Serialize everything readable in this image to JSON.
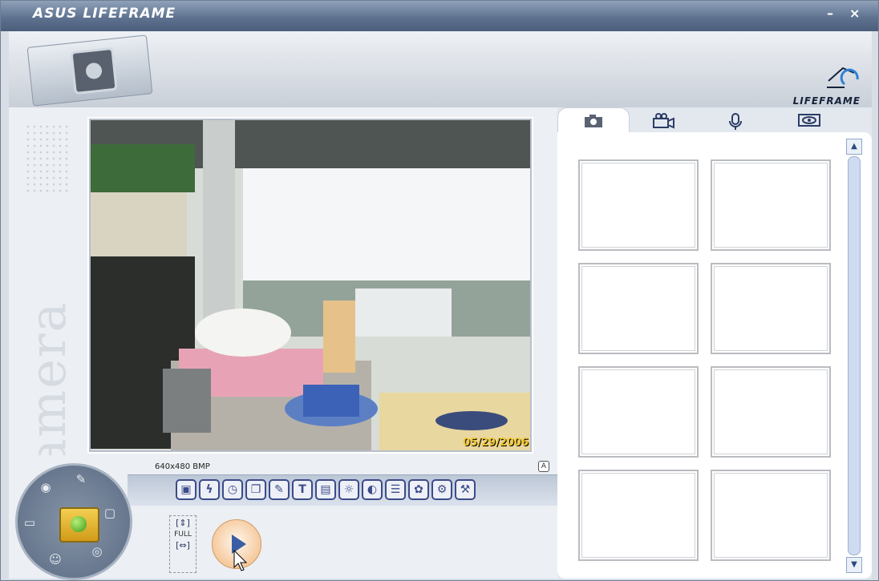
{
  "window": {
    "title": "ASUS LIFEFRAME",
    "minimize": "–",
    "close": "×"
  },
  "header": {
    "logo_text": "LIFEFRAME"
  },
  "mode_label": "Camera",
  "preview": {
    "date_stamp": "05/29/2006",
    "resolution_label": "640x480 BMP",
    "badge": "A"
  },
  "toolbar": {
    "tools": [
      {
        "name": "image-effects-icon",
        "glyph": "▣"
      },
      {
        "name": "flash-icon",
        "glyph": "ϟ"
      },
      {
        "name": "self-timer-icon",
        "glyph": "◷"
      },
      {
        "name": "frames-icon",
        "glyph": "❐"
      },
      {
        "name": "pen-icon",
        "glyph": "✎"
      },
      {
        "name": "text-icon",
        "glyph": "T"
      },
      {
        "name": "stamp-icon",
        "glyph": "▤"
      },
      {
        "name": "brightness-icon",
        "glyph": "☼"
      },
      {
        "name": "contrast-icon",
        "glyph": "◐"
      },
      {
        "name": "list-icon",
        "glyph": "☰"
      },
      {
        "name": "color-icon",
        "glyph": "✿"
      },
      {
        "name": "settings-image-icon",
        "glyph": "⚙"
      },
      {
        "name": "tools-icon",
        "glyph": "⚒"
      }
    ]
  },
  "size_control": {
    "full_label": "FULL"
  },
  "tabs": [
    {
      "name": "tab-camera",
      "icon": "camera-icon"
    },
    {
      "name": "tab-video",
      "icon": "video-camera-icon"
    },
    {
      "name": "tab-audio",
      "icon": "microphone-icon"
    },
    {
      "name": "tab-monitor",
      "icon": "eye-icon"
    }
  ],
  "gallery": {
    "slots": 8
  }
}
